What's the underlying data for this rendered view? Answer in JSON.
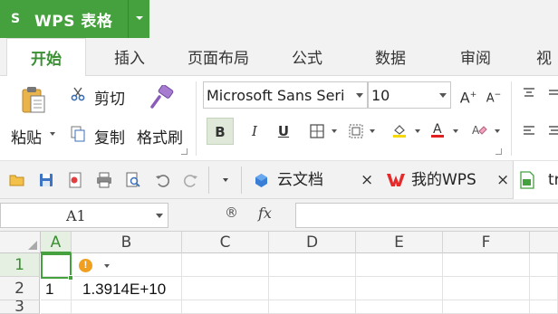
{
  "app": {
    "logo": "S",
    "name": "WPS 表格"
  },
  "ribbon_tabs": [
    "开始",
    "插入",
    "页面布局",
    "公式",
    "数据",
    "审阅",
    "视"
  ],
  "clipboard": {
    "cut": "剪切",
    "copy": "复制",
    "paste": "粘贴",
    "format_painter": "格式刷"
  },
  "font": {
    "family": "Microsoft Sans Seri",
    "size": "10",
    "bold": "B",
    "italic": "I",
    "underline": "U",
    "increase_icon": "A",
    "decrease_icon": "A"
  },
  "doc_tabs": [
    {
      "label": "云文档",
      "icon": "cloud-doc-icon"
    },
    {
      "label": "我的WPS",
      "icon": "wps-logo-icon"
    },
    {
      "label": "tr",
      "icon": "spreadsheet-file-icon"
    }
  ],
  "close_glyph": "×",
  "formula_bar": {
    "cell_ref": "A1",
    "fx": "fx",
    "zoom_glyph": "®",
    "content": ""
  },
  "columns": [
    "A",
    "B",
    "C",
    "D",
    "E",
    "F"
  ],
  "rows": [
    "1",
    "2",
    "3"
  ],
  "cells": {
    "A2": "1",
    "B2": "1.3914E+10"
  },
  "colors": {
    "accent": "#45a03e",
    "active_tab_text": "#3a8f33",
    "error_badge": "#f0a020"
  }
}
